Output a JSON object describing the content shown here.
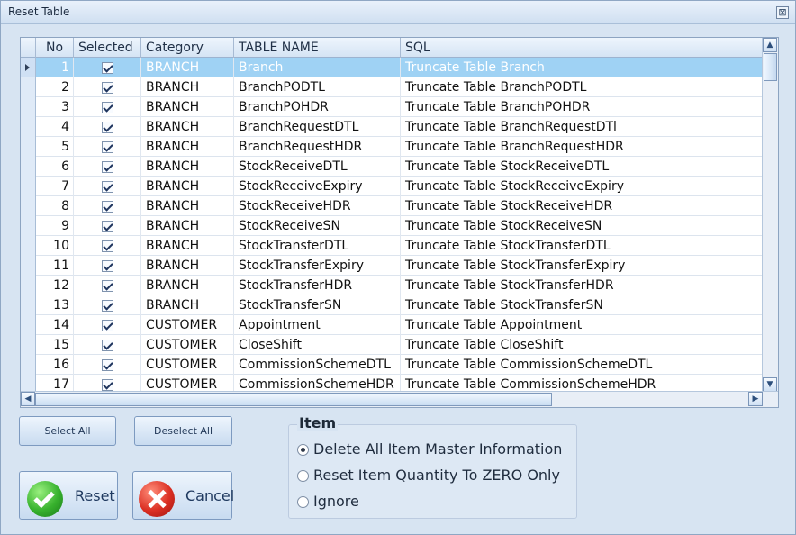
{
  "window": {
    "title": "Reset Table",
    "close_glyph": "⊠"
  },
  "grid": {
    "columns": [
      "No",
      "Selected",
      "Category",
      "TABLE NAME",
      "SQL"
    ],
    "rows": [
      {
        "no": "1",
        "category": "BRANCH",
        "table": "Branch",
        "sql": "Truncate Table Branch",
        "selected": true,
        "current": true
      },
      {
        "no": "2",
        "category": "BRANCH",
        "table": "BranchPODTL",
        "sql": "Truncate Table BranchPODTL",
        "selected": true
      },
      {
        "no": "3",
        "category": "BRANCH",
        "table": "BranchPOHDR",
        "sql": "Truncate Table BranchPOHDR",
        "selected": true
      },
      {
        "no": "4",
        "category": "BRANCH",
        "table": "BranchRequestDTL",
        "sql": "Truncate Table BranchRequestDTl",
        "selected": true
      },
      {
        "no": "5",
        "category": "BRANCH",
        "table": "BranchRequestHDR",
        "sql": "Truncate Table BranchRequestHDR",
        "selected": true
      },
      {
        "no": "6",
        "category": "BRANCH",
        "table": "StockReceiveDTL",
        "sql": "Truncate Table StockReceiveDTL",
        "selected": true
      },
      {
        "no": "7",
        "category": "BRANCH",
        "table": "StockReceiveExpiry",
        "sql": "Truncate Table StockReceiveExpiry",
        "selected": true
      },
      {
        "no": "8",
        "category": "BRANCH",
        "table": "StockReceiveHDR",
        "sql": "Truncate Table StockReceiveHDR",
        "selected": true
      },
      {
        "no": "9",
        "category": "BRANCH",
        "table": "StockReceiveSN",
        "sql": "Truncate Table StockReceiveSN",
        "selected": true
      },
      {
        "no": "10",
        "category": "BRANCH",
        "table": "StockTransferDTL",
        "sql": "Truncate Table StockTransferDTL",
        "selected": true
      },
      {
        "no": "11",
        "category": "BRANCH",
        "table": "StockTransferExpiry",
        "sql": "Truncate Table StockTransferExpiry",
        "selected": true
      },
      {
        "no": "12",
        "category": "BRANCH",
        "table": "StockTransferHDR",
        "sql": "Truncate Table StockTransferHDR",
        "selected": true
      },
      {
        "no": "13",
        "category": "BRANCH",
        "table": "StockTransferSN",
        "sql": "Truncate Table StockTransferSN",
        "selected": true
      },
      {
        "no": "14",
        "category": "CUSTOMER",
        "table": "Appointment",
        "sql": "Truncate Table Appointment",
        "selected": true
      },
      {
        "no": "15",
        "category": "CUSTOMER",
        "table": "CloseShift",
        "sql": "Truncate Table CloseShift",
        "selected": true
      },
      {
        "no": "16",
        "category": "CUSTOMER",
        "table": "CommissionSchemeDTL",
        "sql": "Truncate Table CommissionSchemeDTL",
        "selected": true
      },
      {
        "no": "17",
        "category": "CUSTOMER",
        "table": "CommissionSchemeHDR",
        "sql": "Truncate Table CommissionSchemeHDR",
        "selected": true
      }
    ]
  },
  "buttons": {
    "select_all": "Select All",
    "deselect_all": "Deselect All",
    "reset": "Reset",
    "cancel": "Cancel"
  },
  "item_group": {
    "title": "Item",
    "options": [
      {
        "label": "Delete All Item Master Information",
        "checked": true
      },
      {
        "label": "Reset Item Quantity To ZERO  Only",
        "checked": false
      },
      {
        "label": "Ignore",
        "checked": false
      }
    ]
  }
}
